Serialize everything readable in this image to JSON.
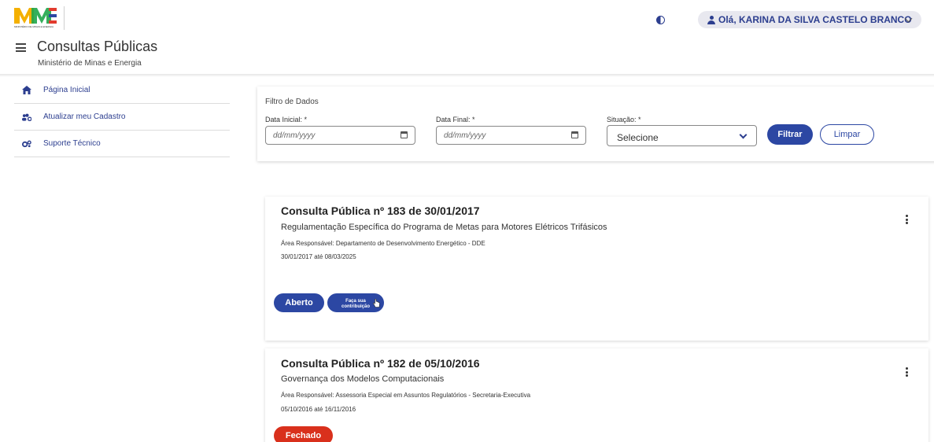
{
  "header": {
    "logo_text": "MINISTÉRIO DE MINAS E ENERGIA",
    "app_title": "Consultas Públicas",
    "app_subtitle": "Ministério de Minas e Energia",
    "user_greeting": "Olá, KARINA DA SILVA CASTELO BRANCO",
    "icons": [
      "menu-icon",
      "contrast-icon",
      "user-icon",
      "chevron-down-icon"
    ]
  },
  "sidebar": {
    "items": [
      {
        "label": "Página Inicial",
        "icon": "home-icon"
      },
      {
        "label": "Atualizar meu Cadastro",
        "icon": "users-cog-icon"
      },
      {
        "label": "Suporte Técnico",
        "icon": "cogs-icon"
      }
    ]
  },
  "filter": {
    "title": "Filtro de Dados",
    "start_label": "Data Inicial: *",
    "start_placeholder": "dd/mm/yyyy",
    "end_label": "Data Final: *",
    "end_placeholder": "dd/mm/yyyy",
    "status_label": "Situação: *",
    "status_value": "Selecione",
    "filter_button": "Filtrar",
    "clear_button": "Limpar"
  },
  "consultations": [
    {
      "title": "Consulta Pública nº 183 de 30/01/2017",
      "description": "Regulamentação Específica do Programa de Metas para Motores Elétricos Trifásicos",
      "area": "Área Responsável: Departamento de Desenvolvimento Energético - DDE",
      "period": "30/01/2017 até 08/03/2025",
      "status": "Aberto",
      "contribute_line1": "Faça sua",
      "contribute_line2": "contribuição"
    },
    {
      "title": "Consulta Pública nº 182 de 05/10/2016",
      "description": "Governança dos Modelos Computacionais",
      "area": "Área Responsável: Assessoria Especial em Assuntos Regulatórios - Secretaria-Executiva",
      "period": "05/10/2016 até 16/11/2016",
      "status": "Fechado"
    }
  ],
  "colors": {
    "primary": "#2c47a3",
    "closed": "#d9301c",
    "nav_text": "#2c3e8f"
  }
}
